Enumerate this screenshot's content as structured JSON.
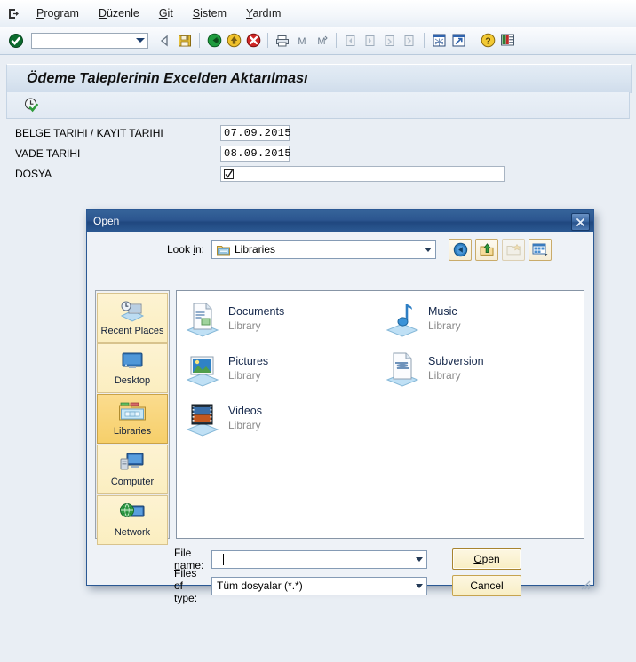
{
  "app": {
    "menu_items": [
      {
        "label": "Program",
        "mnemonic": "P"
      },
      {
        "label": "Düzenle",
        "mnemonic": "D"
      },
      {
        "label": "Git",
        "mnemonic": "G"
      },
      {
        "label": "Sistem",
        "mnemonic": "S"
      },
      {
        "label": "Yardım",
        "mnemonic": "Y"
      }
    ],
    "command_field_value": "",
    "screen_title": "Ödeme Taleplerinin Excelden Aktarılması",
    "toolbar_icons": [
      "enter-check-icon",
      "back-triangle-icon",
      "save-icon",
      "back-green-icon",
      "exit-yellow-icon",
      "cancel-red-icon",
      "print-icon",
      "find-icon",
      "find-next-icon",
      "first-page-icon",
      "previous-page-icon",
      "next-page-icon",
      "last-page-icon",
      "new-session-icon",
      "create-shortcut-icon",
      "help-icon",
      "customize-layout-icon"
    ],
    "app_toolbar_icon": "execute-clock-icon"
  },
  "form": {
    "rows": [
      {
        "label": "BELGE TARIHI / KAYIT TARIHI",
        "value": "07.09.2015",
        "type": "date"
      },
      {
        "label": "VADE TARIHI",
        "value": "08.09.2015",
        "type": "date"
      },
      {
        "label": "DOSYA",
        "value": "",
        "type": "file"
      }
    ]
  },
  "dialog": {
    "title": "Open",
    "close_label": "✕",
    "look_in_label": "Look in:",
    "look_in_value": "Libraries",
    "toolbar_buttons": [
      {
        "name": "back-button",
        "icon": "back-arrow-icon",
        "enabled": true
      },
      {
        "name": "up-one-level-button",
        "icon": "up-folder-icon",
        "enabled": true
      },
      {
        "name": "new-folder-button",
        "icon": "new-folder-icon",
        "enabled": false
      },
      {
        "name": "views-button",
        "icon": "views-grid-icon",
        "enabled": true
      }
    ],
    "places": [
      {
        "label": "Recent Places",
        "icon": "recent-places-icon",
        "selected": false
      },
      {
        "label": "Desktop",
        "icon": "desktop-icon",
        "selected": false
      },
      {
        "label": "Libraries",
        "icon": "libraries-folder-icon",
        "selected": true
      },
      {
        "label": "Computer",
        "icon": "computer-icon",
        "selected": false
      },
      {
        "label": "Network",
        "icon": "network-globe-icon",
        "selected": false
      }
    ],
    "files": [
      {
        "name": "Documents",
        "sub": "Library",
        "icon": "documents-library-icon"
      },
      {
        "name": "Music",
        "sub": "Library",
        "icon": "music-library-icon"
      },
      {
        "name": "Pictures",
        "sub": "Library",
        "icon": "pictures-library-icon"
      },
      {
        "name": "Subversion",
        "sub": "Library",
        "icon": "subversion-library-icon"
      },
      {
        "name": "Videos",
        "sub": "Library",
        "icon": "videos-library-icon"
      }
    ],
    "file_name_label": "File name:",
    "file_name_value": "",
    "files_of_type_label": "Files of type:",
    "files_of_type_value": "Tüm dosyalar (*.*)",
    "open_button": "Open",
    "cancel_button": "Cancel"
  },
  "colors": {
    "window_bg": "#e9eef4",
    "dialog_title_blue": "#2c5690",
    "button_yellow": "#f8eec4",
    "selected_place": "#f6cf6a"
  }
}
